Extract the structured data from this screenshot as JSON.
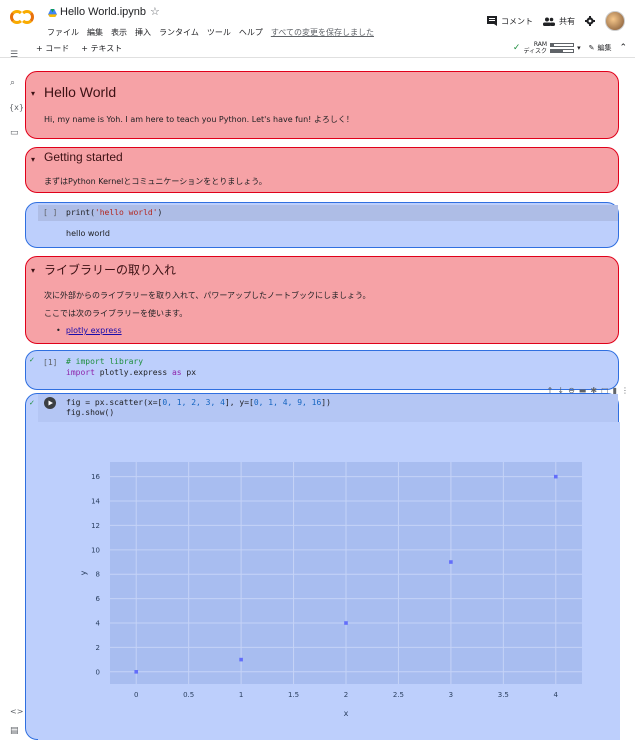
{
  "header": {
    "title": "Hello World.ipynb",
    "menu": [
      "ファイル",
      "編集",
      "表示",
      "挿入",
      "ランタイム",
      "ツール",
      "ヘルプ"
    ],
    "saved_status": "すべての変更を保存しました",
    "comment_label": "コメント",
    "share_label": "共有"
  },
  "toolbar": {
    "add_code": "+ コード",
    "add_text": "+ テキスト",
    "ram_label": "RAM",
    "disk_label": "ディスク",
    "ram_usage": 0.15,
    "disk_usage": 0.55,
    "edit_label": "編集"
  },
  "cells": {
    "hello": {
      "heading": "Hello World",
      "text": "Hi, my name is Yoh. I am here to teach you Python. Let's have fun! よろしく！"
    },
    "started": {
      "heading": "Getting started",
      "text": "まずはPython Kernelとコミュニケーションをとりましょう。"
    },
    "print_cell": {
      "exec": "[ ]",
      "code_fn": "print(",
      "code_str": "'hello world'",
      "code_end": ")",
      "output": "hello world"
    },
    "library": {
      "heading": "ライブラリーの取り入れ",
      "text1": "次に外部からのライブラリーを取り入れて、パワーアップしたノートブックにしましょう。",
      "text2": "ここでは次のライブラリーを使います。",
      "link": "plotly express"
    },
    "import_cell": {
      "exec": "[1]",
      "comment": "# import  library",
      "kw_import": "import",
      "module": " plotly.express ",
      "kw_as": "as",
      "alias": " px"
    },
    "scatter_cell": {
      "line1_a": "fig = px.scatter(x=[",
      "x_vals": "0, 1, 2, 3, 4",
      "line1_b": "], y=[",
      "y_vals": "0, 1, 4, 9, 16",
      "line1_c": "])",
      "line2": "fig.show()"
    }
  },
  "chart_data": {
    "type": "scatter",
    "x": [
      0,
      1,
      2,
      3,
      4
    ],
    "y": [
      0,
      1,
      4,
      9,
      16
    ],
    "xlabel": "x",
    "ylabel": "y",
    "xlim": [
      -0.25,
      4.25
    ],
    "ylim": [
      -1,
      17.2
    ],
    "xticks": [
      "0",
      "0.5",
      "1",
      "1.5",
      "2",
      "2.5",
      "3",
      "3.5",
      "4"
    ],
    "yticks": [
      "0",
      "2",
      "4",
      "6",
      "8",
      "10",
      "12",
      "14",
      "16"
    ],
    "grid": true,
    "marker_color": "#636efa",
    "plot_bg": "#a8bdf0"
  }
}
